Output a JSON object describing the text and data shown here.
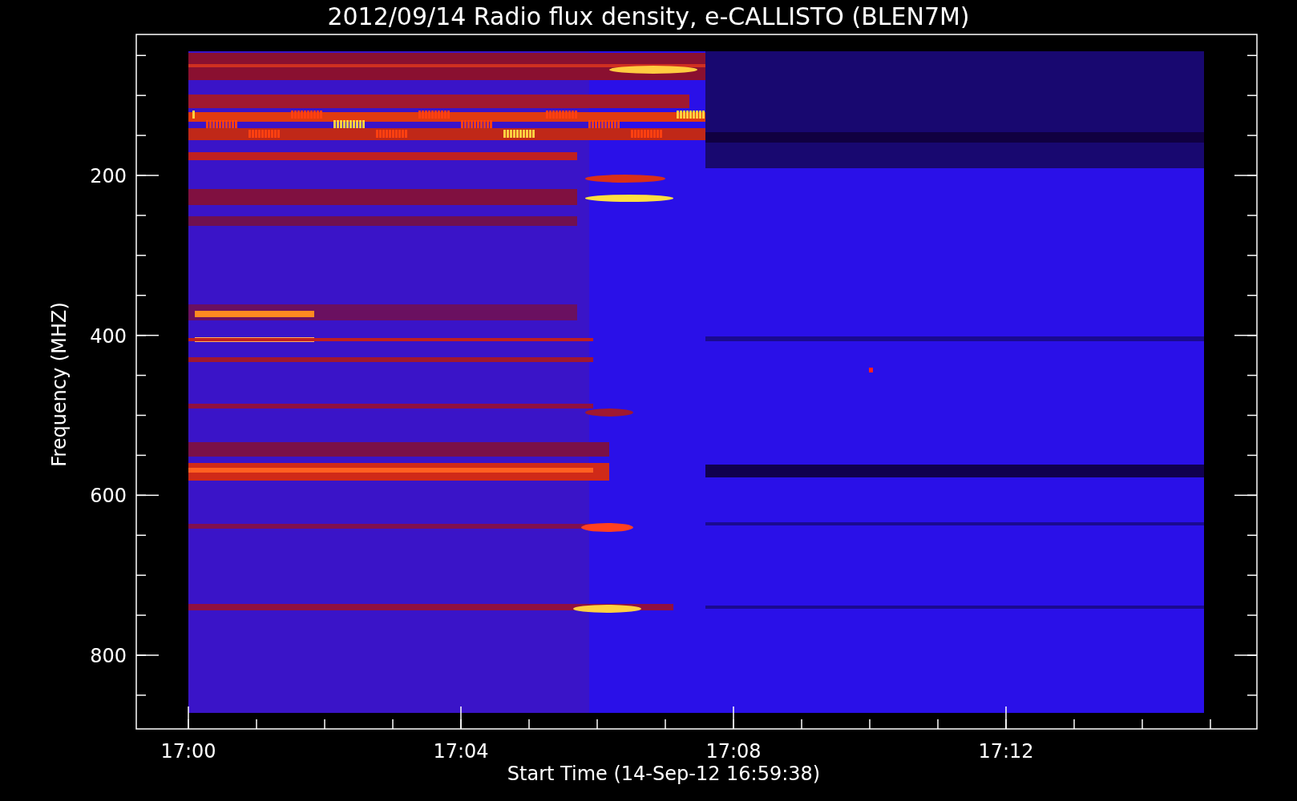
{
  "title": "2012/09/14  Radio flux density, e-CALLISTO (BLEN7M)",
  "y_axis": {
    "label": "Frequency (MHZ)",
    "tick_labels": [
      "200",
      "400",
      "600",
      "800"
    ]
  },
  "x_axis": {
    "label": "Start Time (14-Sep-12 16:59:38)",
    "tick_labels": [
      "17:00",
      "17:04",
      "17:08",
      "17:12"
    ]
  }
}
